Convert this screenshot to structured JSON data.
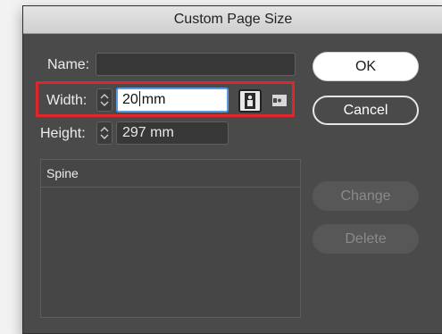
{
  "dialog": {
    "title": "Custom Page Size"
  },
  "name_row": {
    "label": "Name:",
    "value": ""
  },
  "width_row": {
    "label": "Width:",
    "value": "20",
    "unit": "mm"
  },
  "height_row": {
    "label": "Height:",
    "value": "297 mm"
  },
  "orientation": {
    "portrait_icon": "portrait-page-icon",
    "landscape_icon": "landscape-page-icon",
    "selected": "portrait"
  },
  "list": {
    "header": "Spine",
    "items": []
  },
  "buttons": {
    "ok": "OK",
    "cancel": "Cancel",
    "change": "Change",
    "delete": "Delete"
  },
  "colors": {
    "dialog_bg": "#4a4a4a",
    "highlight": "#e0262c",
    "focus_ring": "#5a9be4"
  }
}
